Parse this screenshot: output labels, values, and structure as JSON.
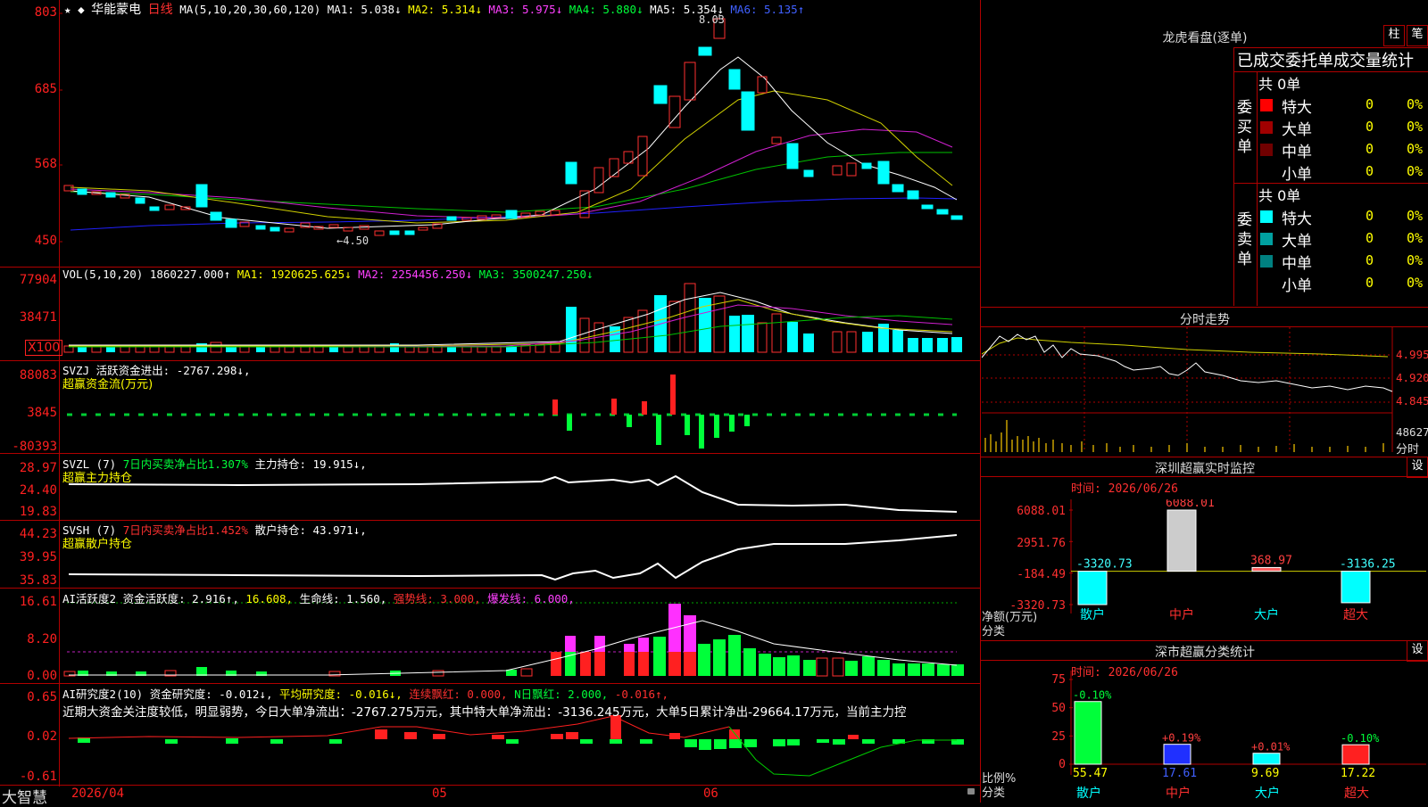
{
  "stock": {
    "name": "华能蒙电",
    "period": "日线"
  },
  "kline": {
    "header": {
      "ma_def": "MA(5,10,20,30,60,120)",
      "ma1": "MA1: 5.038↓",
      "ma2": "MA2: 5.314↓",
      "ma3": "MA3: 5.975↓",
      "ma4": "MA4: 5.880↓",
      "ma5": "MA5: 5.354↓",
      "ma6": "MA6: 5.135↑"
    },
    "y_ticks": [
      "803",
      "685",
      "568",
      "450"
    ],
    "high_note": "8.03",
    "low_note": "←4.50"
  },
  "vol": {
    "header": {
      "def": "VOL(5,10,20)",
      "val": "1860227.000↑",
      "ma1": "MA1: 1920625.625↓",
      "ma2": "MA2: 2254456.250↓",
      "ma3": "MA3: 3500247.250↓"
    },
    "y_ticks": [
      "77904",
      "38471"
    ],
    "unit": "X100"
  },
  "svzj": {
    "header": {
      "name": "SVZJ",
      "label": "活跃资金进出: -2767.298↓,",
      "sub": "超赢资金流(万元)"
    },
    "y_ticks": [
      "88083",
      "3845",
      "-80393"
    ]
  },
  "svzl": {
    "header": {
      "name": "SVZL (7)",
      "ratio": "7日内买卖净占比1.307%",
      "hold": "主力持仓: 19.915↓,",
      "sub": "超赢主力持仓"
    },
    "y_ticks": [
      "28.97",
      "24.40",
      "19.83"
    ]
  },
  "svsh": {
    "header": {
      "name": "SVSH (7)",
      "ratio": "7日内买卖净占比1.452%",
      "hold": "散户持仓: 43.971↓,",
      "sub": "超赢散户持仓"
    },
    "y_ticks": [
      "44.23",
      "39.95",
      "35.83"
    ]
  },
  "ai_active": {
    "header": {
      "name": "AI活跃度2",
      "active": "资金活跃度: 2.916↑,",
      "v2": "16.608,",
      "life": "生命线: 1.560,",
      "strong": "强势线: 3.000,",
      "burst": "爆发线: 6.000,"
    },
    "y_ticks": [
      "16.61",
      "8.20",
      "0.00"
    ]
  },
  "ai_research": {
    "header": {
      "name": "AI研究度2(10)",
      "deg": "资金研究度: -0.012↓,",
      "avg": "平均研究度: -0.016↓,",
      "lianxu": "连续飘红: 0.000,",
      "nday": "N日飘红: 2.000,",
      "last": "-0.016↑,"
    },
    "comment": "近期大资金关注度较低，明显弱势，今日大单净流出：-2767.275万元，其中特大单净流出：-3136.245万元，大单5日累计净出-29664.17万元，当前主力控",
    "y_ticks": [
      "0.65",
      "0.02",
      "-0.61"
    ]
  },
  "bottom_axis": {
    "brand": "大智慧",
    "date": "2026/04",
    "m5": "05",
    "m6": "06"
  },
  "dragon": {
    "title": "龙虎看盘(逐单)",
    "btn_col": "柱",
    "btn_pen": "笔",
    "stat_title": "已成交委托单成交量统计",
    "buy_label": "委买单",
    "sell_label": "委卖单",
    "buy_total": "共 0单",
    "sell_total": "共 0单",
    "buy_rows": [
      {
        "name": "特大",
        "count": "0",
        "pct": "0%",
        "color": "#ff0000"
      },
      {
        "name": "大单",
        "count": "0",
        "pct": "0%",
        "color": "#a00000"
      },
      {
        "name": "中单",
        "count": "0",
        "pct": "0%",
        "color": "#700000"
      },
      {
        "name": "小单",
        "count": "0",
        "pct": "0%",
        "color": ""
      }
    ],
    "sell_rows": [
      {
        "name": "特大",
        "count": "0",
        "pct": "0%",
        "color": "#00ffff"
      },
      {
        "name": "大单",
        "count": "0",
        "pct": "0%",
        "color": "#00a0a0"
      },
      {
        "name": "中单",
        "count": "0",
        "pct": "0%",
        "color": "#008080"
      },
      {
        "name": "小单",
        "count": "0",
        "pct": "0%",
        "color": ""
      }
    ]
  },
  "intraday": {
    "title": "分时走势",
    "y_ticks": [
      "4.995",
      "4.920",
      "4.845"
    ],
    "vol_tick": "48627",
    "vol_label": "分时"
  },
  "sz_monitor": {
    "title": "深圳超赢实时监控",
    "btn": "设",
    "time": "时间: 2026/06/26",
    "y_ticks": [
      "6088.01",
      "2951.76",
      "-184.49",
      "-3320.73"
    ],
    "y_label": "净额(万元)",
    "x_label": "分类",
    "categories": [
      "散户",
      "中户",
      "大户",
      "超大"
    ],
    "values": [
      -3320.73,
      6088.01,
      368.97,
      -3136.25
    ],
    "value_labels": [
      "-3320.73",
      "6088.01",
      "368.97",
      "-3136.25"
    ]
  },
  "sz_class": {
    "title": "深市超赢分类统计",
    "btn": "设",
    "time": "时间: 2026/06/26",
    "y_ticks": [
      "75",
      "50",
      "25",
      "0"
    ],
    "y_label": "比例%",
    "x_label": "分类",
    "categories": [
      "散户",
      "中户",
      "大户",
      "超大"
    ],
    "values": [
      55.47,
      17.61,
      9.69,
      17.22
    ],
    "value_labels": [
      "55.47",
      "17.61",
      "9.69",
      "17.22"
    ],
    "change_labels": [
      "-0.10%",
      "+0.19%",
      "+0.01%",
      "-0.10%"
    ]
  }
}
